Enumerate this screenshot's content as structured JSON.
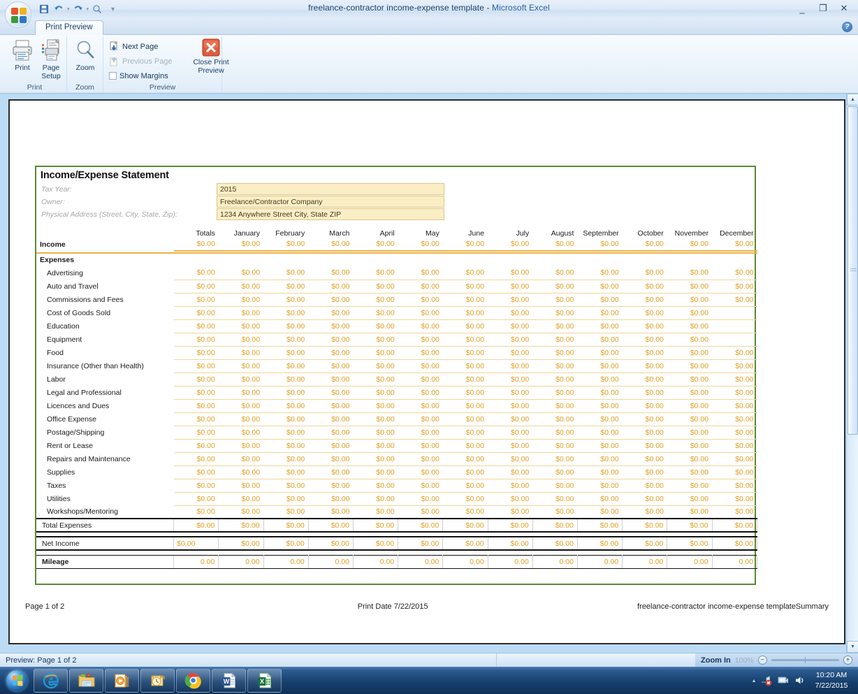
{
  "window": {
    "document_name": "freelance-contractor income-expense template",
    "app_name": "Microsoft Excel",
    "title_separator": " - ",
    "minimize_glyph": "_",
    "restore_glyph": "❐",
    "close_glyph": "✕",
    "help_glyph": "?"
  },
  "quick_access": {
    "save_icon": "save-icon",
    "undo_icon": "undo-icon",
    "redo_icon": "redo-icon",
    "print_preview_icon": "print-preview-icon",
    "customize_icon": "customize-qat-icon",
    "dropdown_glyph": "▾"
  },
  "ribbon": {
    "tab_label": "Print Preview",
    "groups": [
      {
        "name": "Print",
        "label": "Print"
      },
      {
        "name": "Zoom",
        "label": "Zoom"
      },
      {
        "name": "Preview",
        "label": "Preview"
      }
    ],
    "print_button": {
      "line1": "Print",
      "line2": ""
    },
    "page_setup_button": {
      "line1": "Page",
      "line2": "Setup"
    },
    "zoom_button": {
      "line1": "Zoom",
      "line2": ""
    },
    "next_page": "Next Page",
    "previous_page": "Previous Page",
    "show_margins": "Show Margins",
    "close_print_preview": {
      "line1": "Close Print",
      "line2": "Preview"
    }
  },
  "sheet": {
    "title": "Income/Expense Statement",
    "meta": [
      {
        "label": "Tax Year:",
        "value": "2015"
      },
      {
        "label": "Owner:",
        "value": "Freelance/Contractor Company"
      },
      {
        "label": "Physical Address (Street, City, State, Zip):",
        "value": "1234 Anywhere Street  City, State ZIP"
      }
    ],
    "columns": [
      "Totals",
      "January",
      "February",
      "March",
      "April",
      "May",
      "June",
      "July",
      "August",
      "September",
      "October",
      "November",
      "December"
    ],
    "income_label": "Income",
    "expenses_label": "Expenses",
    "zero_money": "$0.00",
    "zero_plain": "0.00",
    "income_values": [
      "$0.00",
      "$0.00",
      "$0.00",
      "$0.00",
      "$0.00",
      "$0.00",
      "$0.00",
      "$0.00",
      "$0.00",
      "$0.00",
      "$0.00",
      "$0.00",
      "$0.00"
    ],
    "expense_rows": [
      {
        "label": "Advertising",
        "values": [
          "$0.00",
          "$0.00",
          "$0.00",
          "$0.00",
          "$0.00",
          "$0.00",
          "$0.00",
          "$0.00",
          "$0.00",
          "$0.00",
          "$0.00",
          "$0.00",
          "$0.00"
        ]
      },
      {
        "label": "Auto and Travel",
        "values": [
          "$0.00",
          "$0.00",
          "$0.00",
          "$0.00",
          "$0.00",
          "$0.00",
          "$0.00",
          "$0.00",
          "$0.00",
          "$0.00",
          "$0.00",
          "$0.00",
          "$0.00"
        ]
      },
      {
        "label": "Commissions and Fees",
        "values": [
          "$0.00",
          "$0.00",
          "$0.00",
          "$0.00",
          "$0.00",
          "$0.00",
          "$0.00",
          "$0.00",
          "$0.00",
          "$0.00",
          "$0.00",
          "$0.00",
          "$0.00"
        ]
      },
      {
        "label": "Cost of Goods Sold",
        "values": [
          "$0.00",
          "$0.00",
          "$0.00",
          "$0.00",
          "$0.00",
          "$0.00",
          "$0.00",
          "$0.00",
          "$0.00",
          "$0.00",
          "$0.00",
          "$0.00",
          ""
        ]
      },
      {
        "label": "Education",
        "values": [
          "$0.00",
          "$0.00",
          "$0.00",
          "$0.00",
          "$0.00",
          "$0.00",
          "$0.00",
          "$0.00",
          "$0.00",
          "$0.00",
          "$0.00",
          "$0.00",
          ""
        ]
      },
      {
        "label": "Equipment",
        "values": [
          "$0.00",
          "$0.00",
          "$0.00",
          "$0.00",
          "$0.00",
          "$0.00",
          "$0.00",
          "$0.00",
          "$0.00",
          "$0.00",
          "$0.00",
          "$0.00",
          ""
        ]
      },
      {
        "label": "Food",
        "values": [
          "$0.00",
          "$0.00",
          "$0.00",
          "$0.00",
          "$0.00",
          "$0.00",
          "$0.00",
          "$0.00",
          "$0.00",
          "$0.00",
          "$0.00",
          "$0.00",
          "$0.00"
        ]
      },
      {
        "label": "Insurance (Other than Health)",
        "values": [
          "$0.00",
          "$0.00",
          "$0.00",
          "$0.00",
          "$0.00",
          "$0.00",
          "$0.00",
          "$0.00",
          "$0.00",
          "$0.00",
          "$0.00",
          "$0.00",
          "$0.00"
        ]
      },
      {
        "label": "Labor",
        "values": [
          "$0.00",
          "$0.00",
          "$0.00",
          "$0.00",
          "$0.00",
          "$0.00",
          "$0.00",
          "$0.00",
          "$0.00",
          "$0.00",
          "$0.00",
          "$0.00",
          "$0.00"
        ]
      },
      {
        "label": "Legal and Professional",
        "values": [
          "$0.00",
          "$0.00",
          "$0.00",
          "$0.00",
          "$0.00",
          "$0.00",
          "$0.00",
          "$0.00",
          "$0.00",
          "$0.00",
          "$0.00",
          "$0.00",
          "$0.00"
        ]
      },
      {
        "label": "Licences and Dues",
        "values": [
          "$0.00",
          "$0.00",
          "$0.00",
          "$0.00",
          "$0.00",
          "$0.00",
          "$0.00",
          "$0.00",
          "$0.00",
          "$0.00",
          "$0.00",
          "$0.00",
          "$0.00"
        ]
      },
      {
        "label": "Office Expense",
        "values": [
          "$0.00",
          "$0.00",
          "$0.00",
          "$0.00",
          "$0.00",
          "$0.00",
          "$0.00",
          "$0.00",
          "$0.00",
          "$0.00",
          "$0.00",
          "$0.00",
          "$0.00"
        ]
      },
      {
        "label": "Postage/Shipping",
        "values": [
          "$0.00",
          "$0.00",
          "$0.00",
          "$0.00",
          "$0.00",
          "$0.00",
          "$0.00",
          "$0.00",
          "$0.00",
          "$0.00",
          "$0.00",
          "$0.00",
          "$0.00"
        ]
      },
      {
        "label": "Rent or Lease",
        "values": [
          "$0.00",
          "$0.00",
          "$0.00",
          "$0.00",
          "$0.00",
          "$0.00",
          "$0.00",
          "$0.00",
          "$0.00",
          "$0.00",
          "$0.00",
          "$0.00",
          "$0.00"
        ]
      },
      {
        "label": "Repairs and Maintenance",
        "values": [
          "$0.00",
          "$0.00",
          "$0.00",
          "$0.00",
          "$0.00",
          "$0.00",
          "$0.00",
          "$0.00",
          "$0.00",
          "$0.00",
          "$0.00",
          "$0.00",
          "$0.00"
        ]
      },
      {
        "label": "Supplies",
        "values": [
          "$0.00",
          "$0.00",
          "$0.00",
          "$0.00",
          "$0.00",
          "$0.00",
          "$0.00",
          "$0.00",
          "$0.00",
          "$0.00",
          "$0.00",
          "$0.00",
          "$0.00"
        ]
      },
      {
        "label": "Taxes",
        "values": [
          "$0.00",
          "$0.00",
          "$0.00",
          "$0.00",
          "$0.00",
          "$0.00",
          "$0.00",
          "$0.00",
          "$0.00",
          "$0.00",
          "$0.00",
          "$0.00",
          "$0.00"
        ]
      },
      {
        "label": "Utilities",
        "values": [
          "$0.00",
          "$0.00",
          "$0.00",
          "$0.00",
          "$0.00",
          "$0.00",
          "$0.00",
          "$0.00",
          "$0.00",
          "$0.00",
          "$0.00",
          "$0.00",
          "$0.00"
        ]
      },
      {
        "label": "Workshops/Mentoring",
        "values": [
          "$0.00",
          "$0.00",
          "$0.00",
          "$0.00",
          "$0.00",
          "$0.00",
          "$0.00",
          "$0.00",
          "$0.00",
          "$0.00",
          "$0.00",
          "$0.00",
          "$0.00"
        ]
      }
    ],
    "total_expenses": {
      "label": "Total Expenses",
      "values": [
        "$0.00",
        "$0.00",
        "$0.00",
        "$0.00",
        "$0.00",
        "$0.00",
        "$0.00",
        "$0.00",
        "$0.00",
        "$0.00",
        "$0.00",
        "$0.00",
        "$0.00"
      ]
    },
    "net_income": {
      "label": "Net Income",
      "values": [
        "$0.00",
        "$0.00",
        "$0.00",
        "$0.00",
        "$0.00",
        "$0.00",
        "$0.00",
        "$0.00",
        "$0.00",
        "$0.00",
        "$0.00",
        "$0.00",
        "$0.00"
      ]
    },
    "mileage": {
      "label": "Mileage",
      "values": [
        "0.00",
        "0.00",
        "0.00",
        "0.00",
        "0.00",
        "0.00",
        "0.00",
        "0.00",
        "0.00",
        "0.00",
        "0.00",
        "0.00",
        "0.00"
      ]
    }
  },
  "page_footer": {
    "left": "Page 1 of 2",
    "center": "Print Date 7/22/2015",
    "right": "freelance-contractor income-expense templateSummary"
  },
  "status_bar": {
    "preview_text": "Preview: Page 1 of 2",
    "zoom_label": "Zoom In",
    "zoom_percent": "100%",
    "zoom_out_glyph": "−",
    "zoom_in_glyph": "+"
  },
  "taskbar": {
    "start_name": "start-button",
    "items": [
      {
        "name": "internet-explorer-icon"
      },
      {
        "name": "windows-explorer-icon"
      },
      {
        "name": "media-player-icon"
      },
      {
        "name": "outlook-icon"
      },
      {
        "name": "google-chrome-icon"
      },
      {
        "name": "microsoft-word-icon"
      },
      {
        "name": "microsoft-excel-icon"
      }
    ],
    "tray": {
      "overflow_glyph": "▴",
      "network_icon": "network-error-icon",
      "action_center_icon": "action-center-icon",
      "volume_icon": "volume-icon",
      "time": "10:20 AM",
      "date": "7/22/2015"
    }
  },
  "colors": {
    "accent_money": "#e0a127",
    "sheet_border": "#5a8a34",
    "input_fill": "#fbeec4",
    "workarea": "#bcdcf5"
  }
}
